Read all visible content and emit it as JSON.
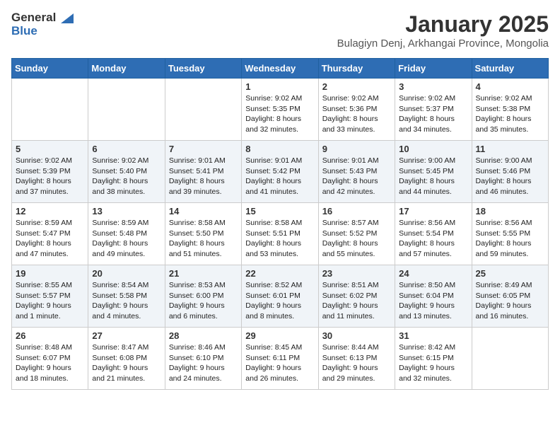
{
  "logo": {
    "general": "General",
    "blue": "Blue"
  },
  "title": "January 2025",
  "subtitle": "Bulagiyn Denj, Arkhangai Province, Mongolia",
  "weekdays": [
    "Sunday",
    "Monday",
    "Tuesday",
    "Wednesday",
    "Thursday",
    "Friday",
    "Saturday"
  ],
  "weeks": [
    [
      {
        "day": null,
        "text": ""
      },
      {
        "day": null,
        "text": ""
      },
      {
        "day": null,
        "text": ""
      },
      {
        "day": "1",
        "text": "Sunrise: 9:02 AM\nSunset: 5:35 PM\nDaylight: 8 hours and 32 minutes."
      },
      {
        "day": "2",
        "text": "Sunrise: 9:02 AM\nSunset: 5:36 PM\nDaylight: 8 hours and 33 minutes."
      },
      {
        "day": "3",
        "text": "Sunrise: 9:02 AM\nSunset: 5:37 PM\nDaylight: 8 hours and 34 minutes."
      },
      {
        "day": "4",
        "text": "Sunrise: 9:02 AM\nSunset: 5:38 PM\nDaylight: 8 hours and 35 minutes."
      }
    ],
    [
      {
        "day": "5",
        "text": "Sunrise: 9:02 AM\nSunset: 5:39 PM\nDaylight: 8 hours and 37 minutes."
      },
      {
        "day": "6",
        "text": "Sunrise: 9:02 AM\nSunset: 5:40 PM\nDaylight: 8 hours and 38 minutes."
      },
      {
        "day": "7",
        "text": "Sunrise: 9:01 AM\nSunset: 5:41 PM\nDaylight: 8 hours and 39 minutes."
      },
      {
        "day": "8",
        "text": "Sunrise: 9:01 AM\nSunset: 5:42 PM\nDaylight: 8 hours and 41 minutes."
      },
      {
        "day": "9",
        "text": "Sunrise: 9:01 AM\nSunset: 5:43 PM\nDaylight: 8 hours and 42 minutes."
      },
      {
        "day": "10",
        "text": "Sunrise: 9:00 AM\nSunset: 5:45 PM\nDaylight: 8 hours and 44 minutes."
      },
      {
        "day": "11",
        "text": "Sunrise: 9:00 AM\nSunset: 5:46 PM\nDaylight: 8 hours and 46 minutes."
      }
    ],
    [
      {
        "day": "12",
        "text": "Sunrise: 8:59 AM\nSunset: 5:47 PM\nDaylight: 8 hours and 47 minutes."
      },
      {
        "day": "13",
        "text": "Sunrise: 8:59 AM\nSunset: 5:48 PM\nDaylight: 8 hours and 49 minutes."
      },
      {
        "day": "14",
        "text": "Sunrise: 8:58 AM\nSunset: 5:50 PM\nDaylight: 8 hours and 51 minutes."
      },
      {
        "day": "15",
        "text": "Sunrise: 8:58 AM\nSunset: 5:51 PM\nDaylight: 8 hours and 53 minutes."
      },
      {
        "day": "16",
        "text": "Sunrise: 8:57 AM\nSunset: 5:52 PM\nDaylight: 8 hours and 55 minutes."
      },
      {
        "day": "17",
        "text": "Sunrise: 8:56 AM\nSunset: 5:54 PM\nDaylight: 8 hours and 57 minutes."
      },
      {
        "day": "18",
        "text": "Sunrise: 8:56 AM\nSunset: 5:55 PM\nDaylight: 8 hours and 59 minutes."
      }
    ],
    [
      {
        "day": "19",
        "text": "Sunrise: 8:55 AM\nSunset: 5:57 PM\nDaylight: 9 hours and 1 minute."
      },
      {
        "day": "20",
        "text": "Sunrise: 8:54 AM\nSunset: 5:58 PM\nDaylight: 9 hours and 4 minutes."
      },
      {
        "day": "21",
        "text": "Sunrise: 8:53 AM\nSunset: 6:00 PM\nDaylight: 9 hours and 6 minutes."
      },
      {
        "day": "22",
        "text": "Sunrise: 8:52 AM\nSunset: 6:01 PM\nDaylight: 9 hours and 8 minutes."
      },
      {
        "day": "23",
        "text": "Sunrise: 8:51 AM\nSunset: 6:02 PM\nDaylight: 9 hours and 11 minutes."
      },
      {
        "day": "24",
        "text": "Sunrise: 8:50 AM\nSunset: 6:04 PM\nDaylight: 9 hours and 13 minutes."
      },
      {
        "day": "25",
        "text": "Sunrise: 8:49 AM\nSunset: 6:05 PM\nDaylight: 9 hours and 16 minutes."
      }
    ],
    [
      {
        "day": "26",
        "text": "Sunrise: 8:48 AM\nSunset: 6:07 PM\nDaylight: 9 hours and 18 minutes."
      },
      {
        "day": "27",
        "text": "Sunrise: 8:47 AM\nSunset: 6:08 PM\nDaylight: 9 hours and 21 minutes."
      },
      {
        "day": "28",
        "text": "Sunrise: 8:46 AM\nSunset: 6:10 PM\nDaylight: 9 hours and 24 minutes."
      },
      {
        "day": "29",
        "text": "Sunrise: 8:45 AM\nSunset: 6:11 PM\nDaylight: 9 hours and 26 minutes."
      },
      {
        "day": "30",
        "text": "Sunrise: 8:44 AM\nSunset: 6:13 PM\nDaylight: 9 hours and 29 minutes."
      },
      {
        "day": "31",
        "text": "Sunrise: 8:42 AM\nSunset: 6:15 PM\nDaylight: 9 hours and 32 minutes."
      },
      {
        "day": null,
        "text": ""
      }
    ]
  ]
}
